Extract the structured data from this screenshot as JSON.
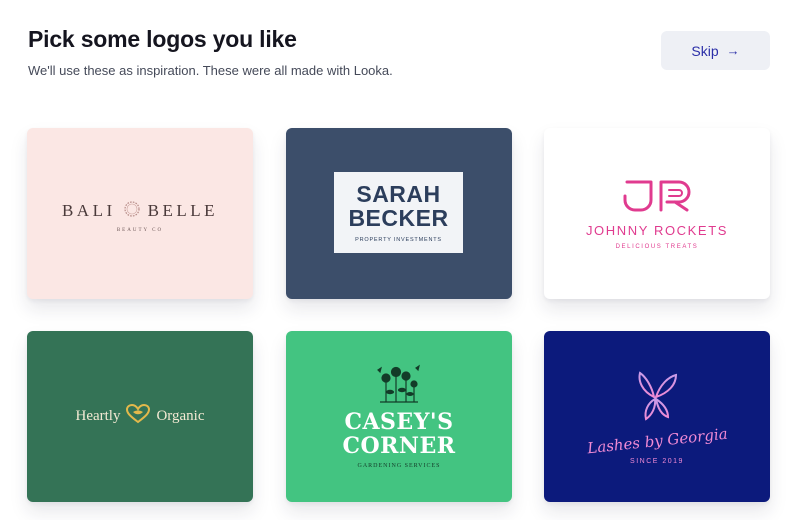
{
  "header": {
    "title": "Pick some logos you like",
    "subtitle": "We'll use these as inspiration. These were all made with Looka.",
    "skip_label": "Skip",
    "skip_arrow": "→"
  },
  "colors": {
    "accent": "#2b2fa8",
    "skip_bg": "#eef0f5"
  },
  "cards": [
    {
      "background": "#fbe7e4",
      "name_left": "BALI",
      "name_right": "BELLE",
      "tagline": "BEAUTY CO",
      "icon": "wreath-icon"
    },
    {
      "background": "#3c4e6a",
      "name_line1": "SARAH",
      "name_line2": "BECKER",
      "tagline": "PROPERTY INVESTMENTS"
    },
    {
      "background": "#ffffff",
      "name": "JOHNNY ROCKETS",
      "tagline": "DELICIOUS TREATS",
      "icon": "jr-monogram-icon"
    },
    {
      "background": "#347356",
      "name_left": "Heartly",
      "name_right": "Organic",
      "icon": "heart-leaf-icon"
    },
    {
      "background": "#43c481",
      "name_line1": "CASEY'S",
      "name_line2": "CORNER",
      "tagline": "GARDENING SERVICES",
      "icon": "flowers-icon"
    },
    {
      "background": "#0c1a7c",
      "name": "Lashes by Georgia",
      "tagline": "SINCE 2019",
      "icon": "butterfly-icon"
    }
  ]
}
